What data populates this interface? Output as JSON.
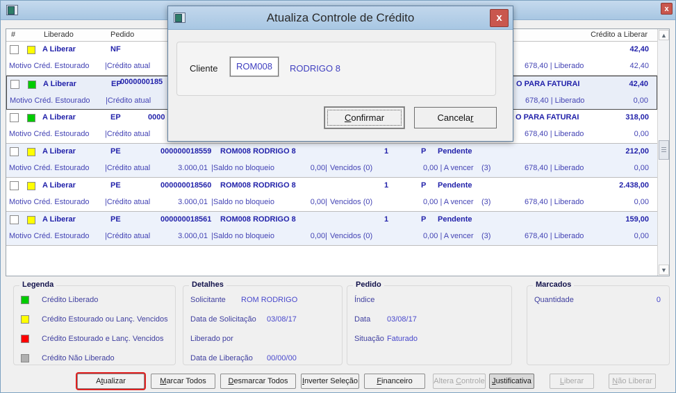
{
  "dialog": {
    "title": "Atualiza Controle de Crédito",
    "close_glyph": "x",
    "cliente_label": "Cliente",
    "cliente_code": "ROM008",
    "cliente_name": "RODRIGO 8",
    "confirm": {
      "label": "Confirmar",
      "u": 0
    },
    "cancel": {
      "label": "Cancelar",
      "u": 7
    }
  },
  "window": {
    "close_glyph": "x"
  },
  "list": {
    "headers": {
      "num": "#",
      "liberado": "Liberado",
      "pedido": "Pedido",
      "credito": "Crédito a Liberar"
    },
    "rows": [
      {
        "alt": false,
        "sel": false,
        "color": "#ffff00",
        "status": "A Liberar",
        "doc": "NF",
        "num": "",
        "client": "",
        "frag": "",
        "qty": "",
        "p": "",
        "situ": "",
        "amount": "42,40",
        "motivo": "Motivo Créd. Estourado",
        "ca": "|Crédito atual",
        "ca_v": "",
        "saldo": "",
        "saldo_v": "",
        "venc": "",
        "av": "",
        "av_n": "",
        "lib": "678,40 | Liberado",
        "lib_v": "42,40"
      },
      {
        "alt": true,
        "sel": true,
        "color": "#00cc00",
        "status": "A Liberar",
        "doc": "EP",
        "num": "0000000185",
        "num_raised": true,
        "client": "",
        "frag": "O PARA FATURAI",
        "qty": "",
        "p": "",
        "situ": "",
        "amount": "42,40",
        "motivo": "Motivo Créd. Estourado",
        "ca": "|Crédito atual",
        "ca_v": "",
        "saldo": "",
        "saldo_v": "",
        "venc": "",
        "av": "",
        "av_n": "",
        "lib": "678,40 | Liberado",
        "lib_v": "0,00"
      },
      {
        "alt": false,
        "sel": false,
        "color": "#00cc00",
        "status": "A Liberar",
        "doc": "EP",
        "num": "0000",
        "num_short": true,
        "client": "",
        "frag": "O PARA FATURAI",
        "qty": "",
        "p": "",
        "situ": "",
        "amount": "318,00",
        "motivo": "Motivo Créd. Estourado",
        "ca": "|Crédito atual",
        "ca_v": "",
        "saldo": "",
        "saldo_v": "",
        "venc": "",
        "av": "",
        "av_n": "",
        "lib": "678,40 | Liberado",
        "lib_v": "0,00"
      },
      {
        "alt": true,
        "sel": false,
        "color": "#ffff00",
        "status": "A Liberar",
        "doc": "PE",
        "num": "000000018559",
        "client": "ROM008 RODRIGO 8",
        "frag": "",
        "qty": "1",
        "p": "P",
        "situ": "Pendente",
        "amount": "212,00",
        "motivo": "Motivo Créd. Estourado",
        "ca": "|Crédito atual",
        "ca_v": "3.000,01",
        "saldo": "|Saldo no bloqueio",
        "saldo_v": "0,00|",
        "venc": "Vencidos  (0)",
        "av": "0,00 | A vencer",
        "av_n": "(3)",
        "lib": "678,40 | Liberado",
        "lib_v": "0,00"
      },
      {
        "alt": false,
        "sel": false,
        "color": "#ffff00",
        "status": "A Liberar",
        "doc": "PE",
        "num": "000000018560",
        "client": "ROM008 RODRIGO 8",
        "frag": "",
        "qty": "1",
        "p": "P",
        "situ": "Pendente",
        "amount": "2.438,00",
        "motivo": "Motivo Créd. Estourado",
        "ca": "|Crédito atual",
        "ca_v": "3.000,01",
        "saldo": "|Saldo no bloqueio",
        "saldo_v": "0,00|",
        "venc": "Vencidos  (0)",
        "av": "0,00 | A vencer",
        "av_n": "(3)",
        "lib": "678,40 | Liberado",
        "lib_v": "0,00"
      },
      {
        "alt": true,
        "sel": false,
        "color": "#ffff00",
        "status": "A Liberar",
        "doc": "PE",
        "num": "000000018561",
        "client": "ROM008 RODRIGO 8",
        "frag": "",
        "qty": "1",
        "p": "P",
        "situ": "Pendente",
        "amount": "159,00",
        "motivo": "Motivo Créd. Estourado",
        "ca": "|Crédito atual",
        "ca_v": "3.000,01",
        "saldo": "|Saldo no bloqueio",
        "saldo_v": "0,00|",
        "venc": "Vencidos  (0)",
        "av": "0,00 | A vencer",
        "av_n": "(3)",
        "lib": "678,40 | Liberado",
        "lib_v": "0,00"
      }
    ]
  },
  "legend": {
    "title": "Legenda",
    "items": [
      {
        "color": "#00cc00",
        "label": "Crédito Liberado"
      },
      {
        "color": "#ffff00",
        "label": "Crédito Estourado ou Lanç. Vencidos"
      },
      {
        "color": "#ff0000",
        "label": "Crédito Estourado e Lanç. Vencidos"
      },
      {
        "color": "#b0b0b0",
        "label": "Crédito Não Liberado"
      }
    ]
  },
  "detalhes": {
    "title": "Detalhes",
    "rows": [
      {
        "label": "Solicitante",
        "value": "ROM RODRIGO",
        "vx": 83
      },
      {
        "label": "Data de Solicitação",
        "value": "03/08/17",
        "vx": 120
      },
      {
        "label": "Liberado por",
        "value": "",
        "vx": 120
      },
      {
        "label": "Data de Liberação",
        "value": "00/00/00",
        "vx": 120
      }
    ]
  },
  "pedido": {
    "title": "Pedido",
    "rows": [
      {
        "label": "Índice",
        "value": "",
        "vx": 57
      },
      {
        "label": "Data",
        "value": "03/08/17",
        "vx": 57
      },
      {
        "label": "Situação",
        "value": "Faturado",
        "vx": 57
      }
    ]
  },
  "marcados": {
    "title": "Marcados",
    "label": "Quantidade",
    "value": "0"
  },
  "buttons": [
    {
      "label": "Atualizar",
      "u": 1,
      "style": "hl"
    },
    {
      "label": "Marcar Todos",
      "u": 0
    },
    {
      "label": "Desmarcar Todos",
      "u": 0
    },
    {
      "label": "Inverter Seleção",
      "u": 0
    },
    {
      "label": "Financeiro",
      "u": 0
    },
    {
      "label": "Altera Controle",
      "u": 7,
      "disabled": true
    },
    {
      "label": "Justificativa",
      "u": 0,
      "style": "dark"
    },
    {
      "label": "Liberar",
      "u": 0,
      "disabled": true
    },
    {
      "label": "Não Liberar",
      "u": 0,
      "disabled": true
    }
  ]
}
